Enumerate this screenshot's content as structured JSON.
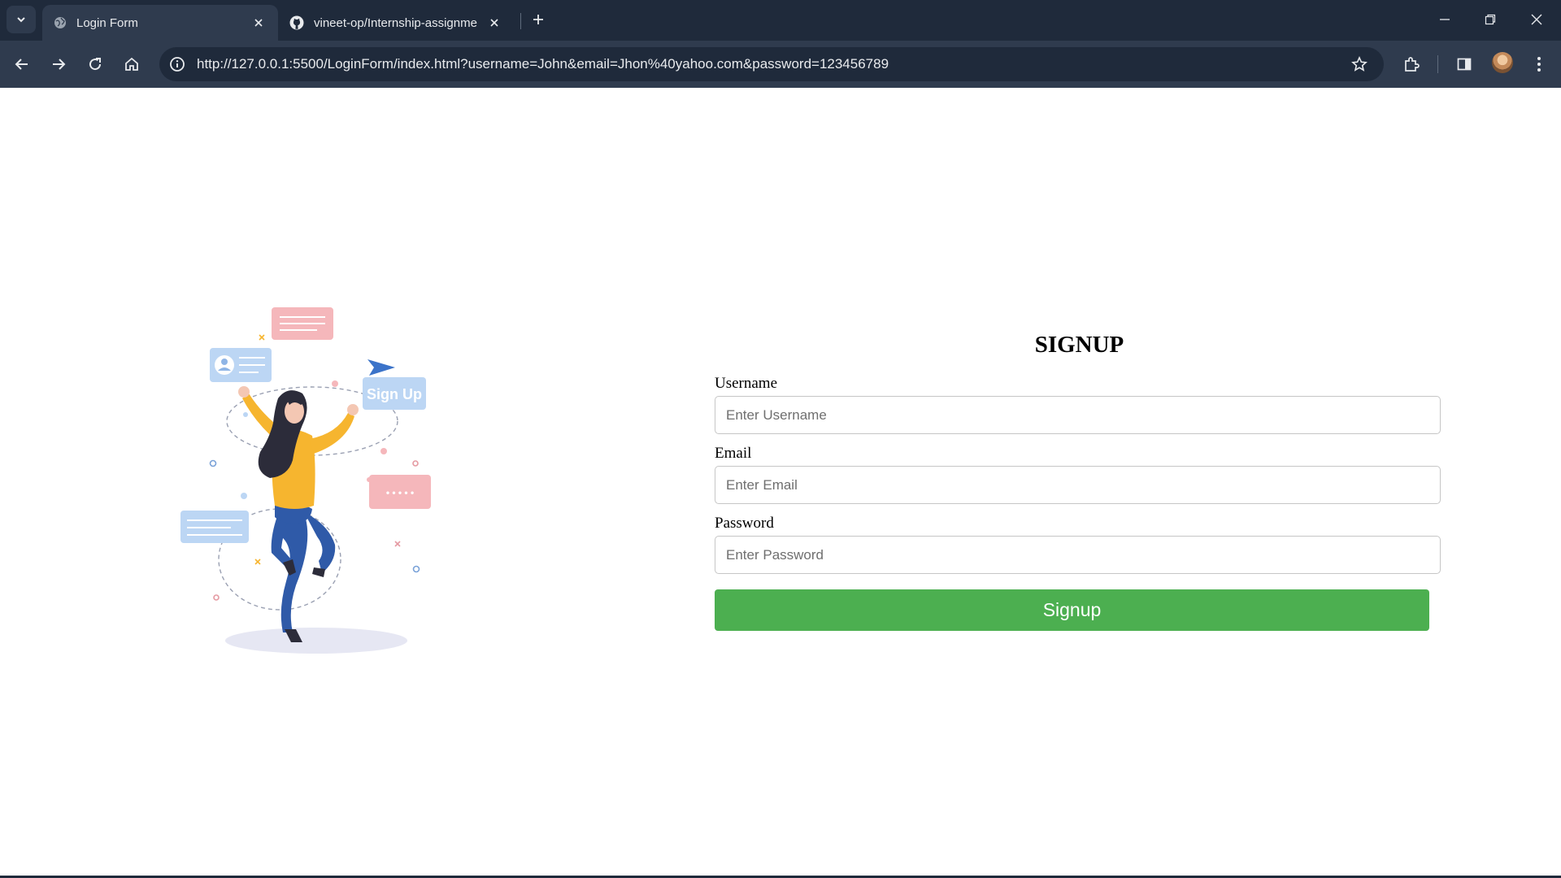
{
  "browser": {
    "tabs": [
      {
        "title": "Login Form",
        "active": true,
        "icon": "globe-icon"
      },
      {
        "title": "vineet-op/Internship-assignme",
        "active": false,
        "icon": "github-icon"
      }
    ],
    "url": "http://127.0.0.1:5500/LoginForm/index.html?username=John&email=Jhon%40yahoo.com&password=123456789"
  },
  "illustration": {
    "sign_up_card_text": "Sign Up",
    "password_card_text": "• • • • •"
  },
  "form": {
    "title": "SIGNUP",
    "username": {
      "label": "Username",
      "placeholder": "Enter Username"
    },
    "email": {
      "label": "Email",
      "placeholder": "Enter Email"
    },
    "password": {
      "label": "Password",
      "placeholder": "Enter Password"
    },
    "submit_label": "Signup",
    "submit_color": "#4caf50"
  },
  "colors": {
    "chrome_dark": "#1f2a3b",
    "chrome_toolbar": "#2f3b4e",
    "figure_shirt": "#f6b52f",
    "figure_pants": "#2f5aa8"
  }
}
